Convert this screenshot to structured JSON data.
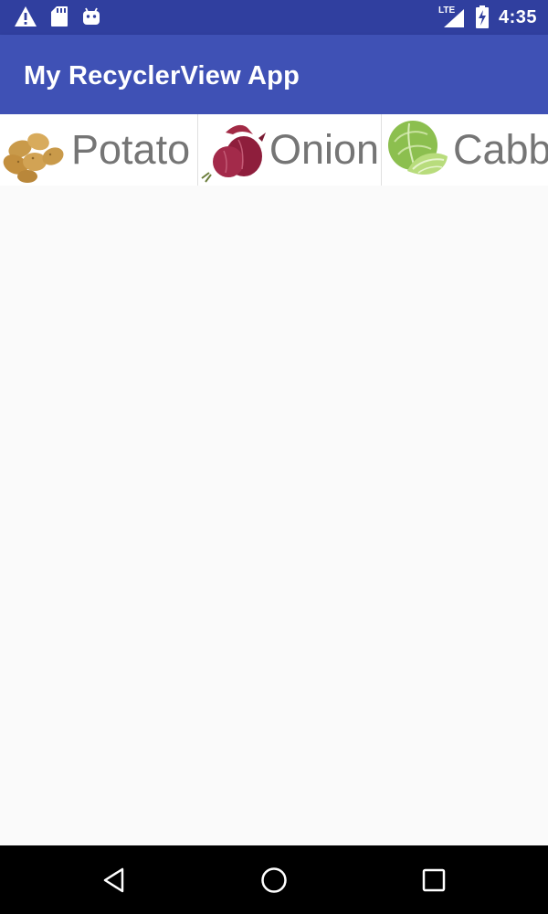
{
  "status_bar": {
    "time": "4:35",
    "network_type": "LTE",
    "left_icons": [
      "warning-icon",
      "sd-card-icon",
      "android-icon"
    ],
    "right_icons": [
      "signal-icon",
      "battery-charging-icon"
    ]
  },
  "app_bar": {
    "title": "My RecyclerView App",
    "color": "#3f51b5",
    "status_color": "#303f9f"
  },
  "list": {
    "items": [
      {
        "label": "Potato",
        "icon": "potato-icon"
      },
      {
        "label": "Onion",
        "icon": "onion-icon"
      },
      {
        "label": "Cabb",
        "icon": "cabbage-icon"
      }
    ]
  },
  "nav_bar": {
    "buttons": [
      "back-icon",
      "home-icon",
      "recents-icon"
    ]
  }
}
